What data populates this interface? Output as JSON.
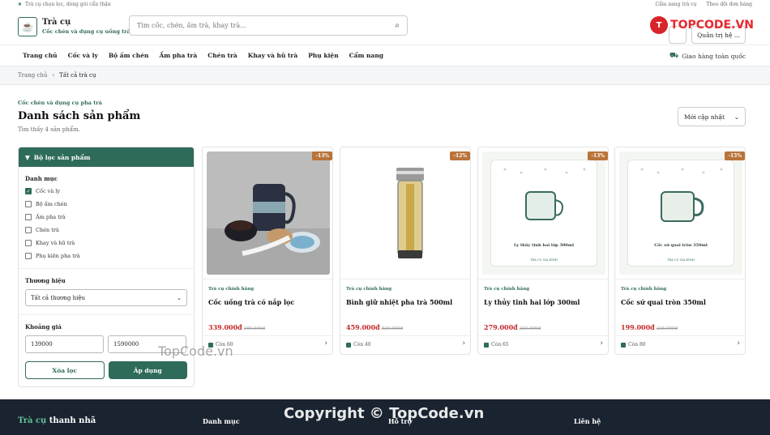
{
  "topbar": {
    "left_text": "Trà cụ chọn lọc, dòng gói cẩn thận",
    "links": [
      "Cẩm nang trà cụ",
      "Theo dõi đơn hàng"
    ]
  },
  "header": {
    "brand_name": "Trà cụ",
    "brand_tagline": "Cốc chén và dụng cụ uống trà",
    "search_placeholder": "Tìm cốc, chén, ấm trà, khay trà...",
    "account_label": "Quản trị hệ ...",
    "watermark_logo": "TOPCODE.VN"
  },
  "nav": {
    "items": [
      "Trang chủ",
      "Cốc và ly",
      "Bộ ấm chén",
      "Ấm pha trà",
      "Chén trà",
      "Khay và hũ trà",
      "Phụ kiện",
      "Cẩm nang"
    ],
    "shipping": "Giao hàng toàn quốc"
  },
  "breadcrumb": {
    "home": "Trang chủ",
    "sep": "›",
    "current": "Tất cả trà cụ"
  },
  "listing": {
    "kicker": "Cốc chén và dụng cụ pha trà",
    "title": "Danh sách sản phẩm",
    "count": "Tìm thấy 4 sản phẩm.",
    "sort": "Mới cập nhật"
  },
  "filter": {
    "title": "Bộ lọc sản phẩm",
    "category_label": "Danh mục",
    "categories": [
      {
        "label": "Cốc và ly",
        "checked": true
      },
      {
        "label": "Bộ ấm chén",
        "checked": false
      },
      {
        "label": "Ấm pha trà",
        "checked": false
      },
      {
        "label": "Chén trà",
        "checked": false
      },
      {
        "label": "Khay và hũ trà",
        "checked": false
      },
      {
        "label": "Phụ kiện pha trà",
        "checked": false
      }
    ],
    "brand_label": "Thương hiệu",
    "brand_value": "Tất cả thương hiệu",
    "price_label": "Khoảng giá",
    "price_min": "139000",
    "price_max": "1590000",
    "clear_label": "Xóa lọc",
    "apply_label": "Áp dụng"
  },
  "products": [
    {
      "badge": "-13%",
      "tag": "Trà cụ chính hãng",
      "name": "Cốc uống trà có nắp lọc",
      "price": "339.000đ",
      "old_price": "390.000đ",
      "stock": "Còn 60"
    },
    {
      "badge": "-12%",
      "tag": "Trà cụ chính hãng",
      "name": "Bình giữ nhiệt pha trà 500ml",
      "price": "459.000đ",
      "old_price": "520.000đ",
      "stock": "Còn 40"
    },
    {
      "badge": "-13%",
      "tag": "Trà cụ chính hãng",
      "name": "Ly thủy tinh hai lớp 300ml",
      "price": "279.000đ",
      "old_price": "320.000đ",
      "stock": "Còn 65",
      "image_caption": "Ly thủy tinh hai lớp 300ml",
      "image_sub": "TRÀ CỤ GIA ĐÌNH"
    },
    {
      "badge": "-15%",
      "tag": "Trà cụ chính hãng",
      "name": "Cốc sứ quai tròn 350ml",
      "price": "199.000đ",
      "old_price": "235.000đ",
      "stock": "Còn 80",
      "image_caption": "Cốc sứ quai tròn 350ml",
      "image_sub": "TRÀ CỤ GIA ĐÌNH"
    }
  ],
  "watermarks": {
    "mid": "TopCode.vn",
    "footer": "Copyright © TopCode.vn"
  },
  "footer": {
    "brand_green": "Trà cụ",
    "brand_white": " thanh nhã",
    "cols": [
      "Danh mục",
      "Hỗ trợ",
      "Liên hệ"
    ]
  },
  "colors": {
    "accent": "#2f6b5a",
    "price": "#c62828",
    "badge": "#b9743a",
    "footer_bg": "#1a2430"
  }
}
